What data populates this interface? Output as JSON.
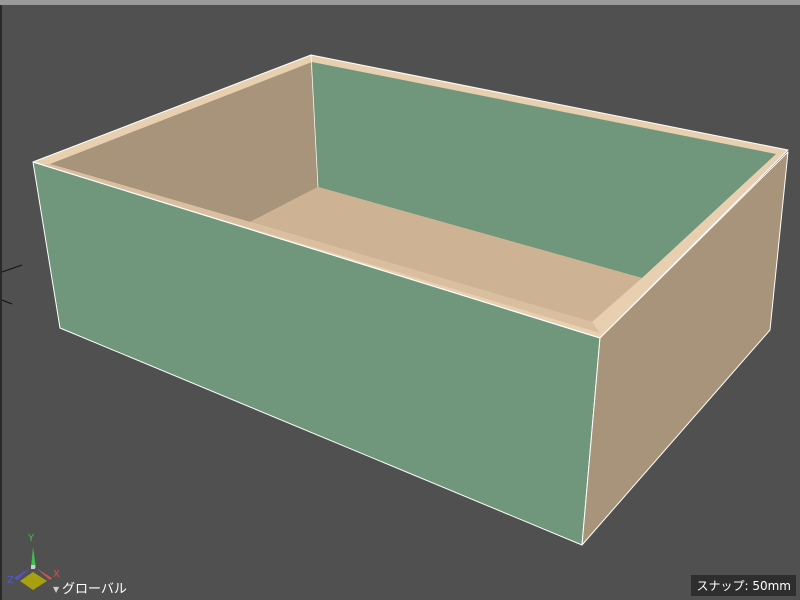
{
  "viewport": {
    "coordinate_mode": "グローバル",
    "snap_label": "スナップ: 50mm",
    "axes": {
      "x": "X",
      "y": "Y",
      "z": "Z"
    }
  },
  "colors": {
    "background": "#505050",
    "green_face": "#70977b",
    "tan_face": "#a8947a",
    "floor": "#cdb393",
    "rim": "#e8cfb0"
  }
}
